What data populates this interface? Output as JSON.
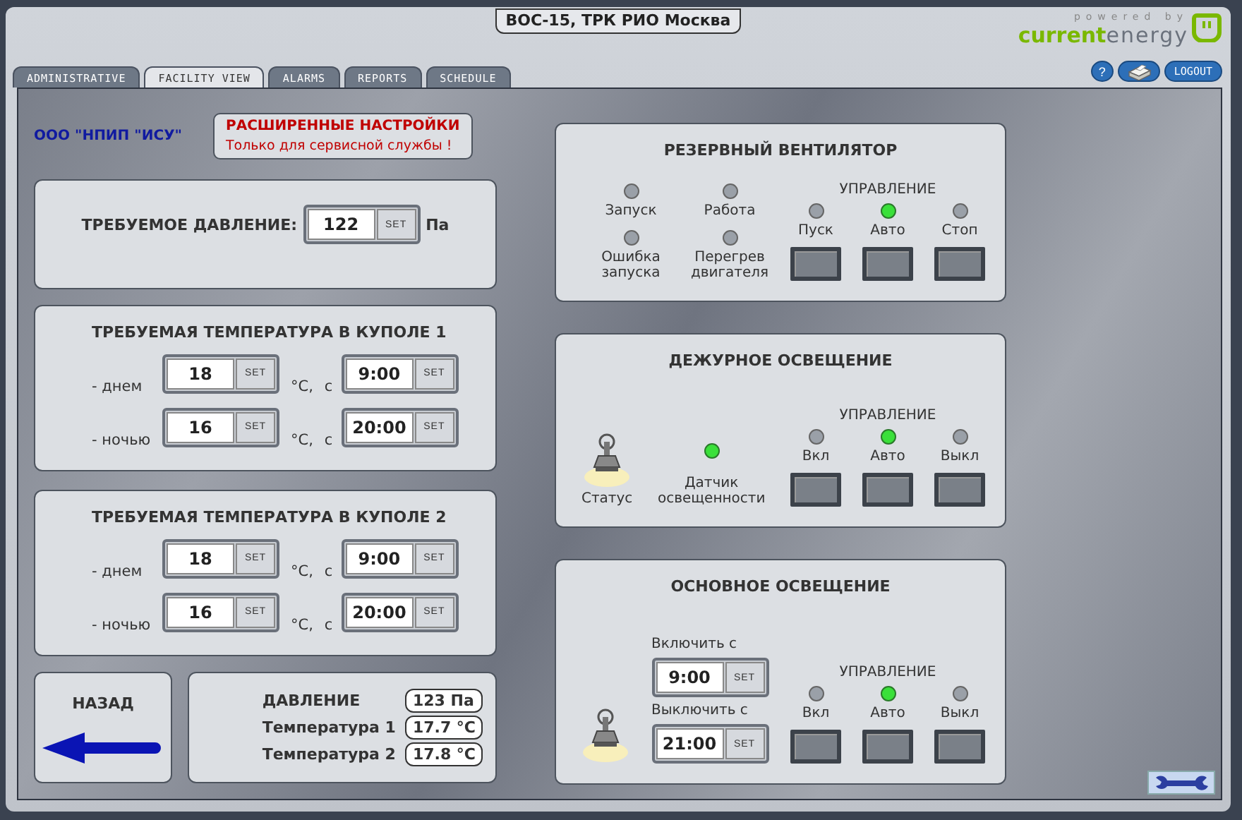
{
  "header": {
    "title": "ВОС-15, ТРК РИО Москва",
    "logo": {
      "tagline": "powered by",
      "brand_first": "current",
      "brand_second": "energy"
    },
    "help_button": "?",
    "logout_button": "LOGOUT"
  },
  "tabs": [
    {
      "label": "ADMINISTRATIVE",
      "selected": false
    },
    {
      "label": "FACILITY VIEW",
      "selected": true
    },
    {
      "label": "ALARMS",
      "selected": false
    },
    {
      "label": "REPORTS",
      "selected": false
    },
    {
      "label": "SCHEDULE",
      "selected": false
    }
  ],
  "company": "ООО \"НПИП \"ИСУ\"",
  "service_notice": {
    "title": "РАСШИРЕННЫЕ НАСТРОЙКИ",
    "text": "Только для сервисной службы !"
  },
  "pressure_setpoint": {
    "label": "ТРЕБУЕМОЕ ДАВЛЕНИЕ:",
    "value": "122",
    "button": "SET",
    "unit": "Па"
  },
  "domes": [
    {
      "title": "ТРЕБУЕМАЯ ТЕМПЕРАТУРА В КУПОЛЕ 1",
      "rows": [
        {
          "label": "- днем",
          "temperature": "18",
          "temperature_button": "SET",
          "unit": "°C,",
          "from": "с",
          "time": "9:00",
          "time_button": "SET"
        },
        {
          "label": "- ночью",
          "temperature": "16",
          "temperature_button": "SET",
          "unit": "°C,",
          "from": "с",
          "time": "20:00",
          "time_button": "SET"
        }
      ]
    },
    {
      "title": "ТРЕБУЕМАЯ ТЕМПЕРАТУРА В КУПОЛЕ 2",
      "rows": [
        {
          "label": "- днем",
          "temperature": "18",
          "temperature_button": "SET",
          "unit": "°C,",
          "from": "с",
          "time": "9:00",
          "time_button": "SET"
        },
        {
          "label": "- ночью",
          "temperature": "16",
          "temperature_button": "SET",
          "unit": "°C,",
          "from": "с",
          "time": "20:00",
          "time_button": "SET"
        }
      ]
    }
  ],
  "back_button": "НАЗАД",
  "readings": [
    {
      "label": "ДАВЛЕНИЕ",
      "value": "123 Па"
    },
    {
      "label": "Температура 1",
      "value": "17.7 °C"
    },
    {
      "label": "Температура 2",
      "value": "17.8 °C"
    }
  ],
  "reserve_fan": {
    "title": "РЕЗЕРВНЫЙ ВЕНТИЛЯТОР",
    "indicators": [
      {
        "label": "Запуск",
        "on": false
      },
      {
        "label": "Работа",
        "on": false
      },
      {
        "label": "Ошибка запуска",
        "on": false
      },
      {
        "label": "Перегрев двигателя",
        "on": false
      }
    ],
    "control": {
      "title": "УПРАВЛЕНИЕ",
      "modes": [
        {
          "label": "Пуск",
          "selected": false
        },
        {
          "label": "Авто",
          "selected": true
        },
        {
          "label": "Стоп",
          "selected": false
        }
      ]
    }
  },
  "duty_lighting": {
    "title": "ДЕЖУРНОЕ ОСВЕЩЕНИЕ",
    "lamp": {
      "label": "Статус",
      "on": true
    },
    "sensor": {
      "label": "Датчик освещенности",
      "on": true
    },
    "control": {
      "title": "УПРАВЛЕНИЕ",
      "modes": [
        {
          "label": "Вкл",
          "selected": false
        },
        {
          "label": "Авто",
          "selected": true
        },
        {
          "label": "Выкл",
          "selected": false
        }
      ]
    }
  },
  "main_lighting": {
    "title": "ОСНОВНОЕ ОСВЕЩЕНИЕ",
    "lamp": {
      "on": true
    },
    "on_time": {
      "label": "Включить с",
      "value": "9:00",
      "button": "SET"
    },
    "off_time": {
      "label": "Выключить с",
      "value": "21:00",
      "button": "SET"
    },
    "control": {
      "title": "УПРАВЛЕНИЕ",
      "modes": [
        {
          "label": "Вкл",
          "selected": false
        },
        {
          "label": "Авто",
          "selected": true
        },
        {
          "label": "Выкл",
          "selected": false
        }
      ]
    }
  }
}
